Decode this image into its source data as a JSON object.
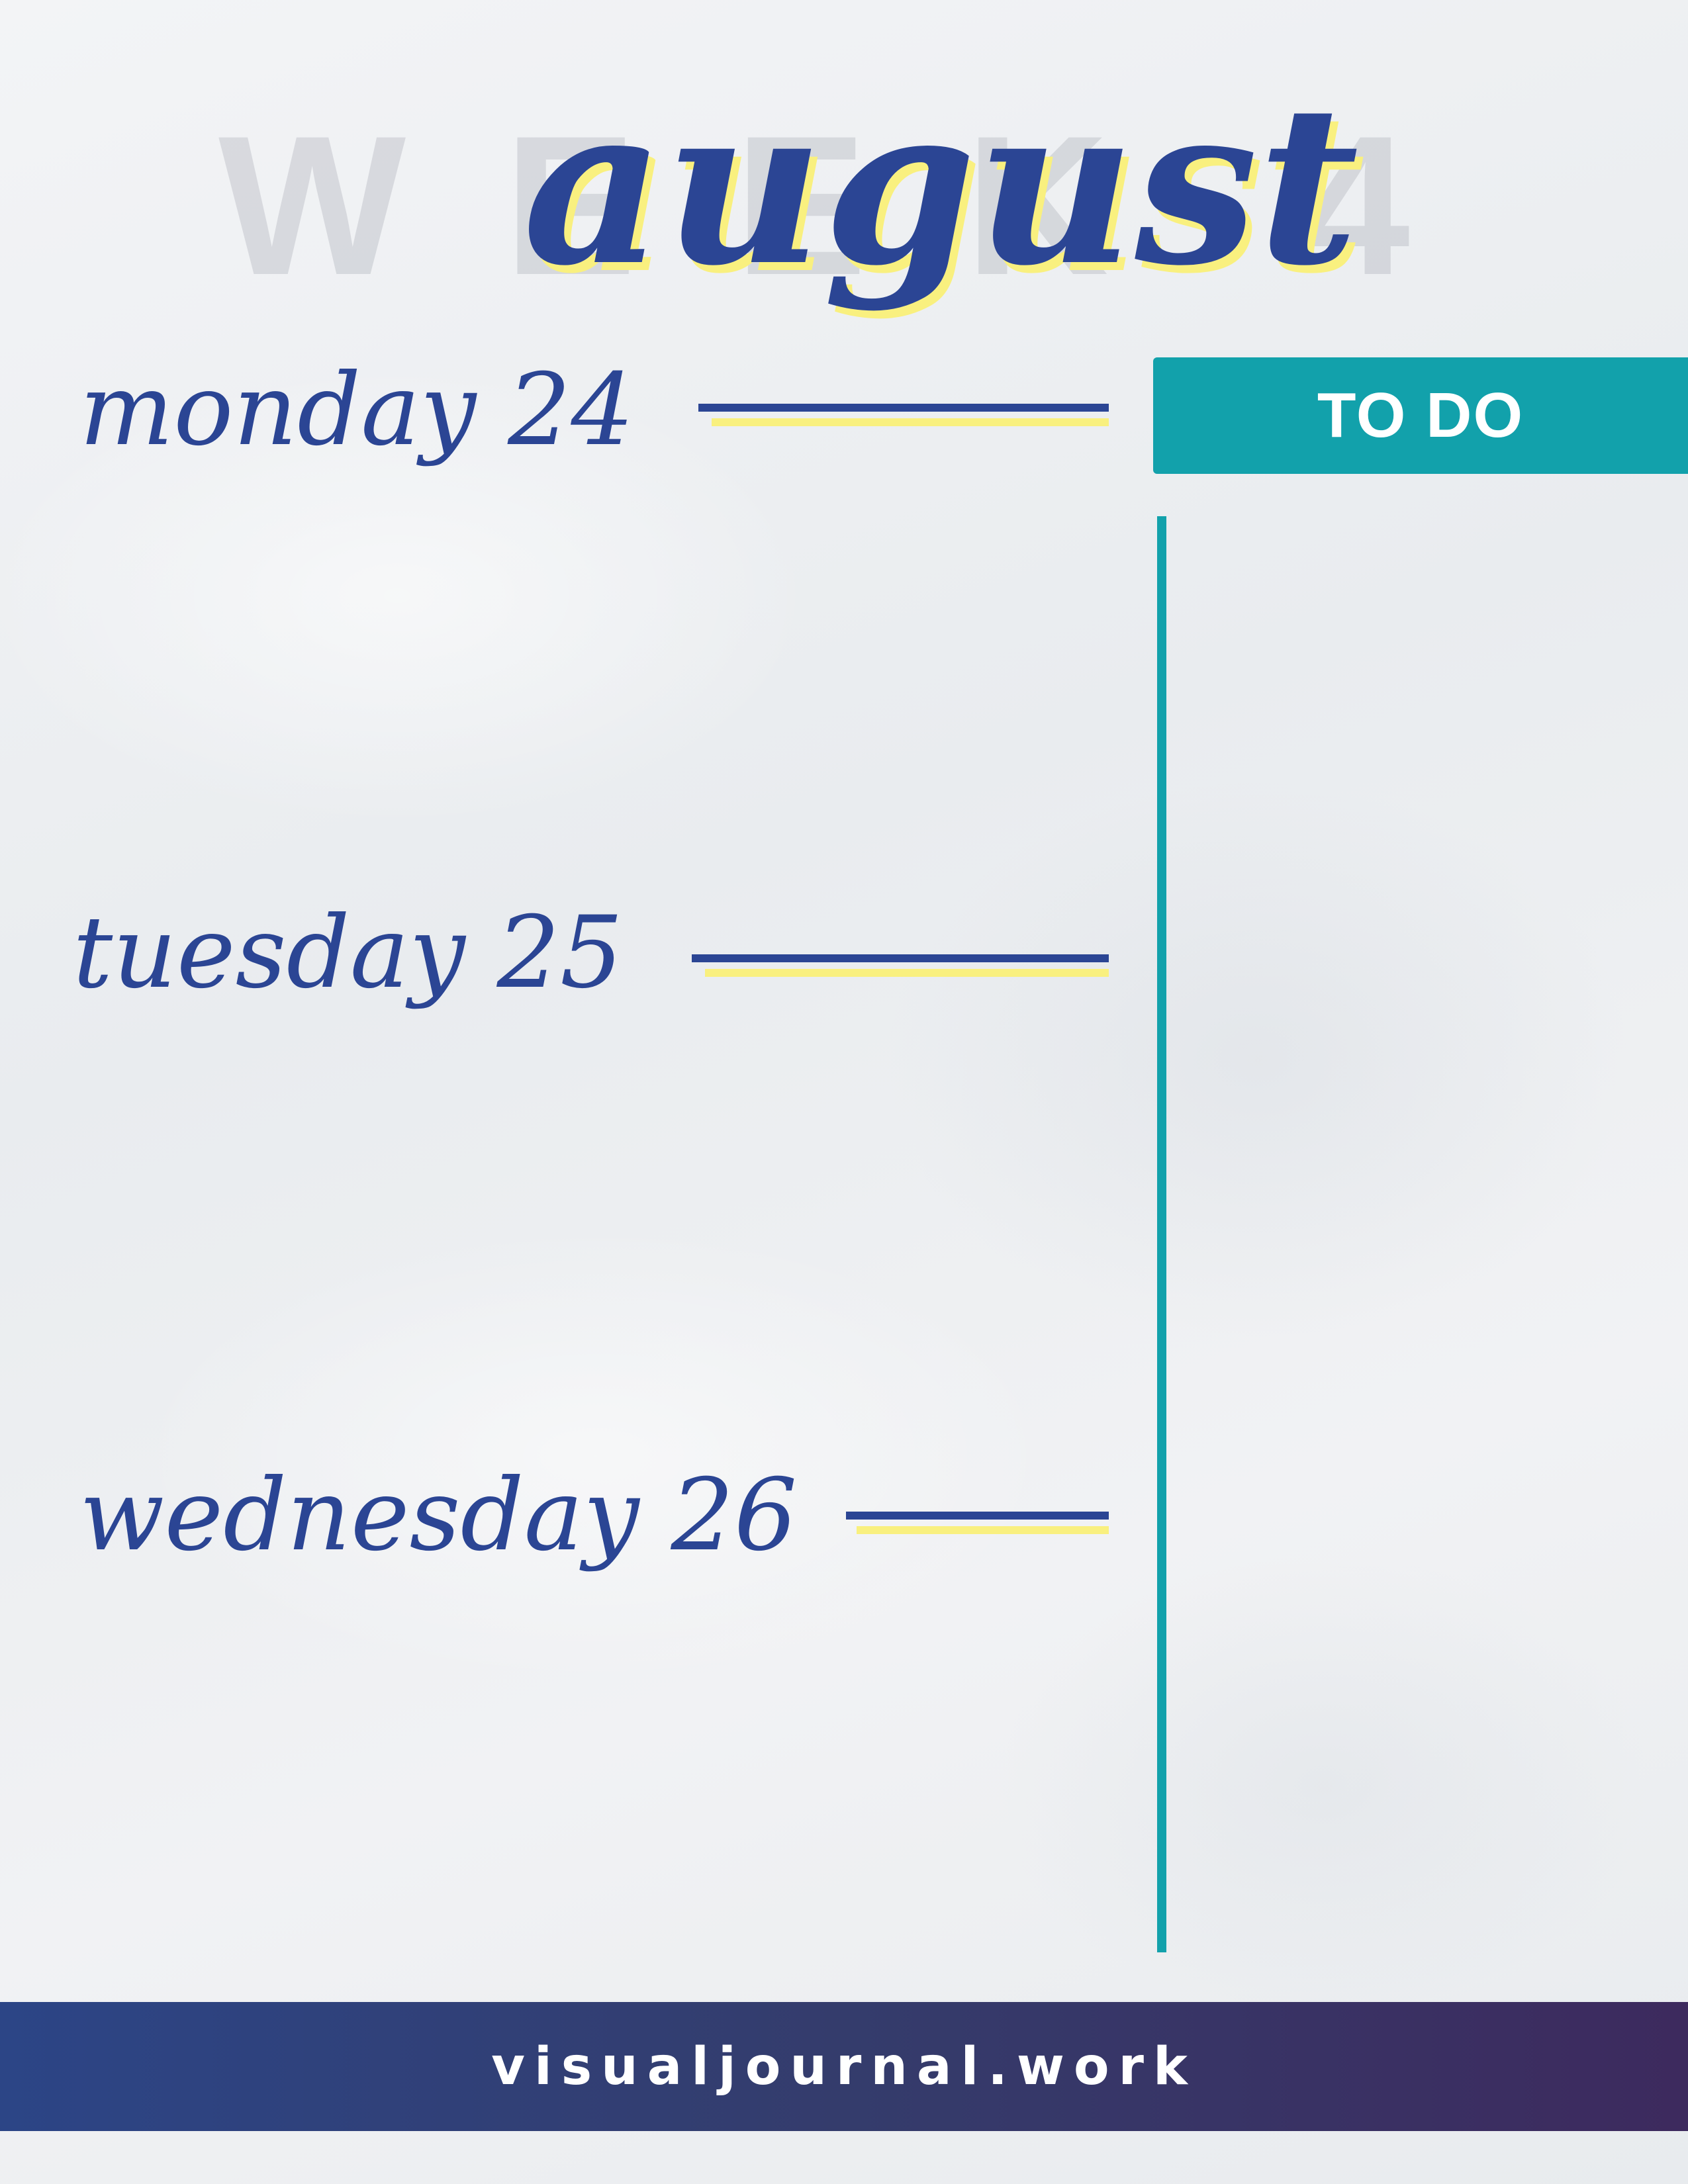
{
  "watermark": {
    "letters": [
      "W",
      "E",
      "E",
      "K",
      "4"
    ]
  },
  "title": "august",
  "days": [
    {
      "label": "monday 24"
    },
    {
      "label": "tuesday 25"
    },
    {
      "label": "wednesday 26"
    }
  ],
  "todo": {
    "label": "TO DO"
  },
  "footer": {
    "text": "visualjournal.work"
  },
  "colors": {
    "navy": "#2b4594",
    "yellow": "#f9f07f",
    "teal": "#12a1ab",
    "footer_start": "#2c4586",
    "footer_end": "#3d2a5e"
  }
}
